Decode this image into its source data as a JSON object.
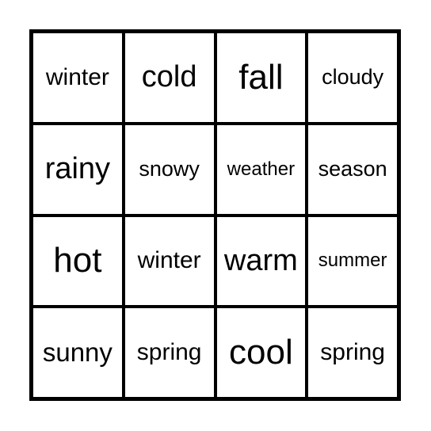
{
  "card": {
    "cells": [
      {
        "text": "winter",
        "size": "s4"
      },
      {
        "text": "cold",
        "size": "s2"
      },
      {
        "text": "fall",
        "size": "s1"
      },
      {
        "text": "cloudy",
        "size": "s5"
      },
      {
        "text": "rainy",
        "size": "s2"
      },
      {
        "text": "snowy",
        "size": "s5"
      },
      {
        "text": "weather",
        "size": "s6"
      },
      {
        "text": "season",
        "size": "s5"
      },
      {
        "text": "hot",
        "size": "s1"
      },
      {
        "text": "winter",
        "size": "s4"
      },
      {
        "text": "warm",
        "size": "s2"
      },
      {
        "text": "summer",
        "size": "s6"
      },
      {
        "text": "sunny",
        "size": "s3"
      },
      {
        "text": "spring",
        "size": "s4"
      },
      {
        "text": "cool",
        "size": "s1"
      },
      {
        "text": "spring",
        "size": "s4"
      }
    ]
  }
}
